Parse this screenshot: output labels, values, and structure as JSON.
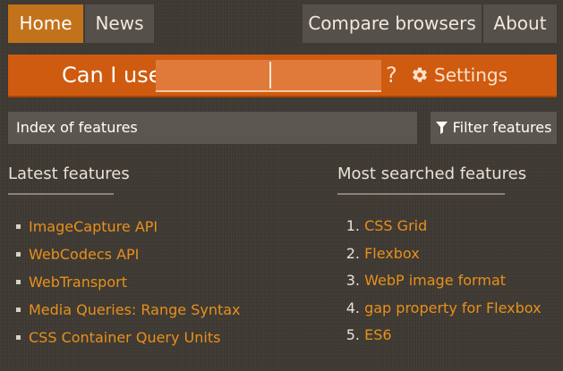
{
  "nav": {
    "home": "Home",
    "news": "News",
    "compare": "Compare browsers",
    "about": "About"
  },
  "search": {
    "prefix": "Can I use",
    "value": "",
    "suffix": "?",
    "settings_label": "Settings"
  },
  "index": {
    "label": "Index of features",
    "filter_label": "Filter features"
  },
  "latest": {
    "heading": "Latest features",
    "items": [
      {
        "label": "ImageCapture API"
      },
      {
        "label": "WebCodecs API"
      },
      {
        "label": "WebTransport"
      },
      {
        "label": "Media Queries: Range Syntax"
      },
      {
        "label": "CSS Container Query Units"
      }
    ]
  },
  "most": {
    "heading": "Most searched features",
    "items": [
      {
        "num": "1.",
        "label": "CSS Grid"
      },
      {
        "num": "2.",
        "label": "Flexbox"
      },
      {
        "num": "3.",
        "label": "WebP image format"
      },
      {
        "num": "4.",
        "label": "gap property for Flexbox"
      },
      {
        "num": "5.",
        "label": "ES6"
      }
    ]
  },
  "icons": {
    "settings": "gear-icon",
    "filter": "filter-icon"
  },
  "colors": {
    "background": "#3f3a33",
    "accent": "#cf5b10",
    "active_tab": "#c2721a",
    "link": "#e8901c",
    "button": "#55504a"
  }
}
